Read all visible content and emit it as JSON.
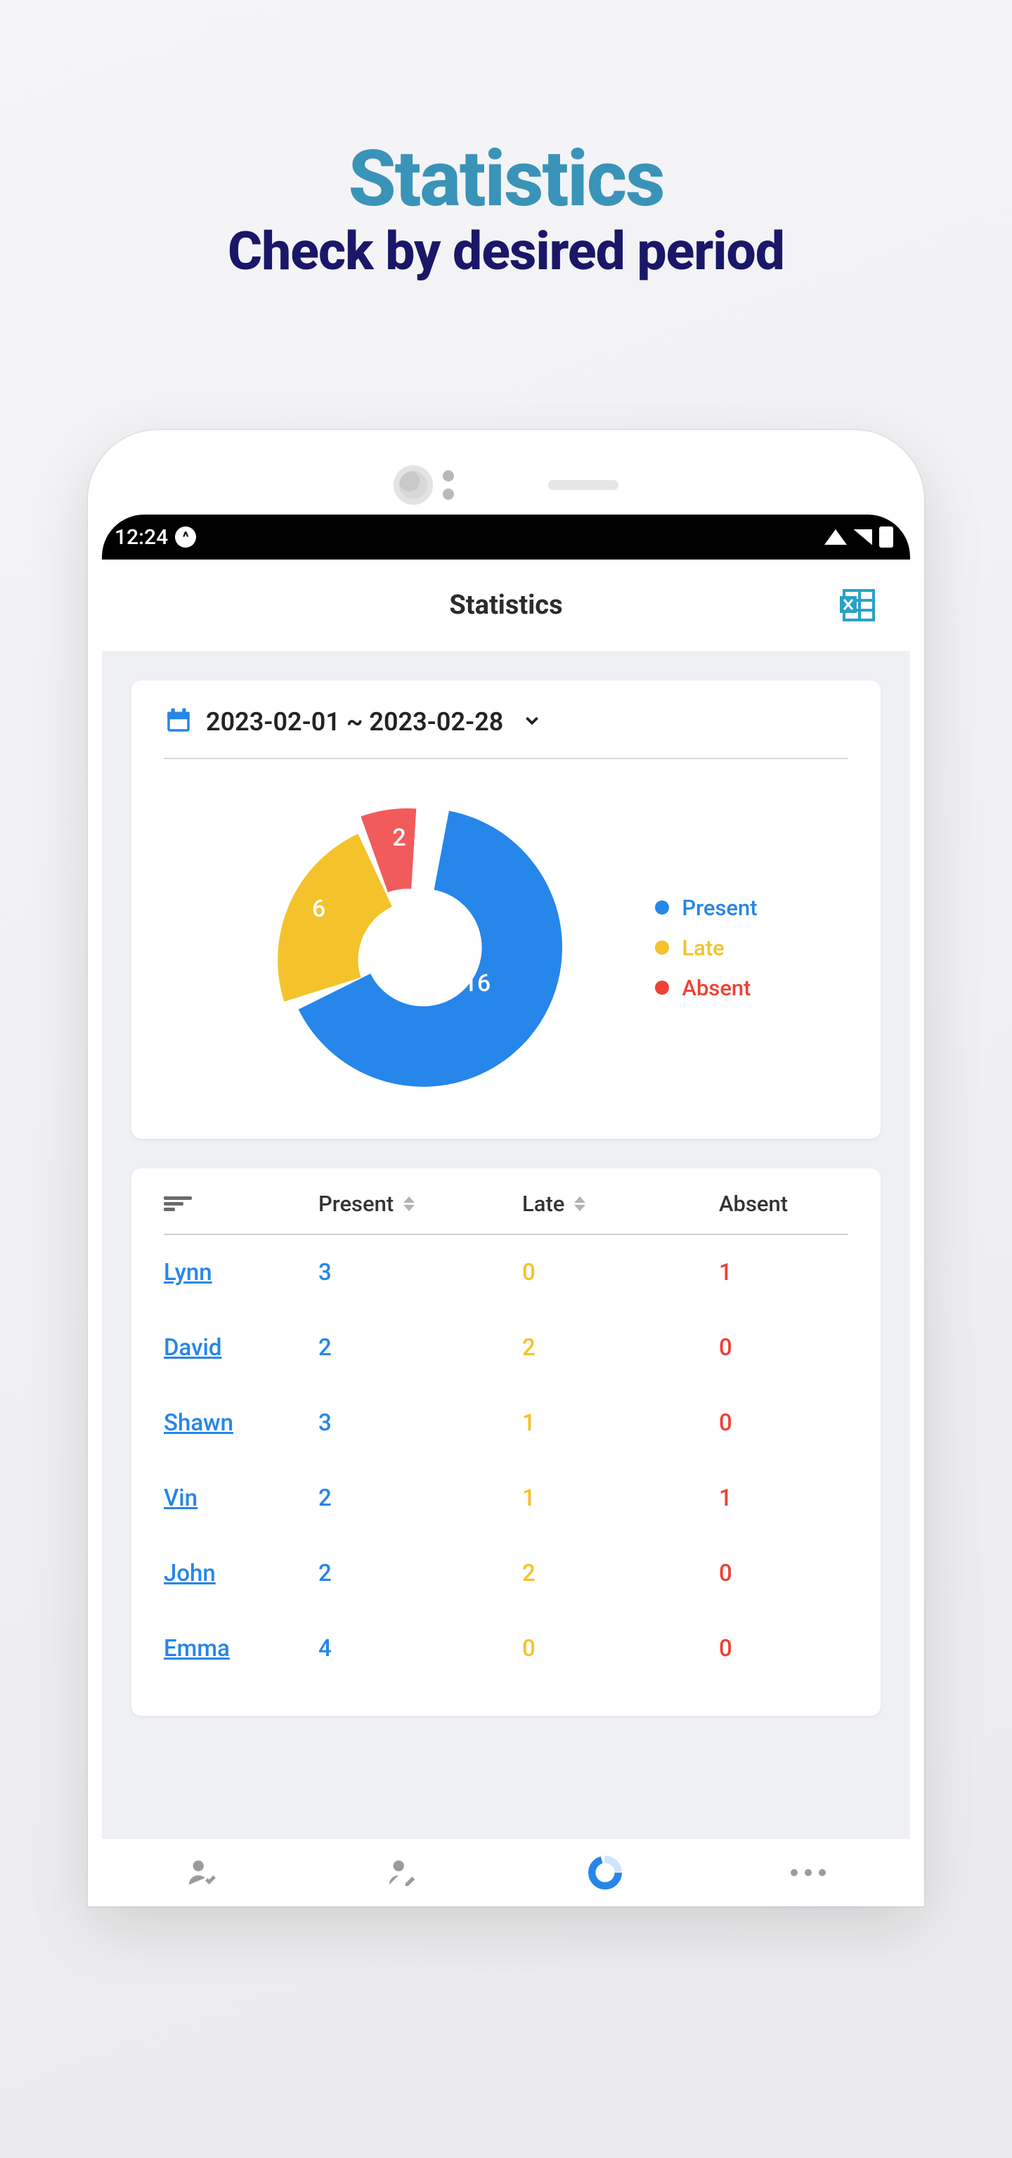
{
  "promo": {
    "title": "Statistics",
    "subtitle": "Check by desired period"
  },
  "status_bar": {
    "time": "12:24"
  },
  "header": {
    "title": "Statistics"
  },
  "date_range": "2023-02-01 ~ 2023-02-28",
  "chart_data": {
    "type": "pie",
    "title": "",
    "series": [
      {
        "name": "Present",
        "value": 16,
        "color": "#2686ea"
      },
      {
        "name": "Late",
        "value": 6,
        "color": "#f4c22b"
      },
      {
        "name": "Absent",
        "value": 2,
        "color": "#f15b5b"
      }
    ]
  },
  "legend": {
    "present": "Present",
    "late": "Late",
    "absent": "Absent"
  },
  "table": {
    "columns": {
      "present": "Present",
      "late": "Late",
      "absent": "Absent"
    },
    "rows": [
      {
        "name": "Lynn",
        "present": "3",
        "late": "0",
        "absent": "1"
      },
      {
        "name": "David",
        "present": "2",
        "late": "2",
        "absent": "0"
      },
      {
        "name": "Shawn",
        "present": "3",
        "late": "1",
        "absent": "0"
      },
      {
        "name": "Vin",
        "present": "2",
        "late": "1",
        "absent": "1"
      },
      {
        "name": "John",
        "present": "2",
        "late": "2",
        "absent": "0"
      },
      {
        "name": "Emma",
        "present": "4",
        "late": "0",
        "absent": "0"
      }
    ]
  }
}
